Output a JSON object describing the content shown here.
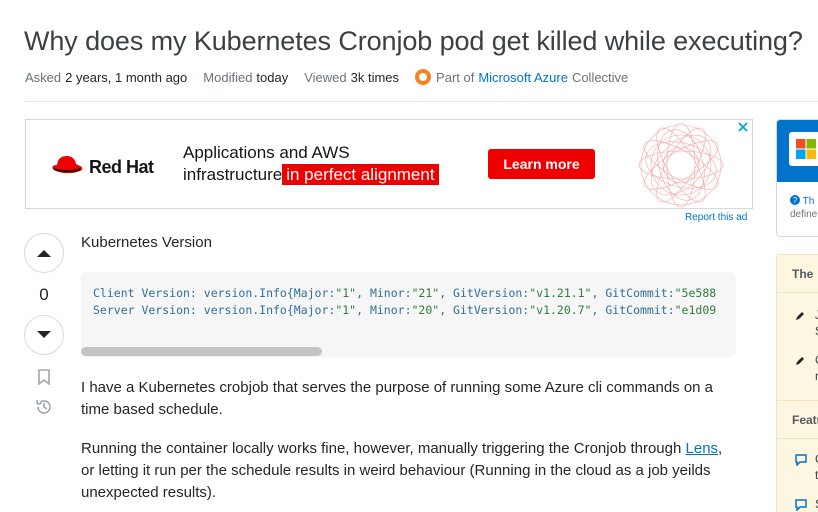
{
  "question": {
    "title": "Why does my Kubernetes Cronjob pod get killed while executing?",
    "asked_label": "Asked",
    "asked_value": "2 years, 1 month ago",
    "modified_label": "Modified",
    "modified_value": "today",
    "viewed_label": "Viewed",
    "viewed_value": "3k times",
    "collective_prefix": "Part of",
    "collective_link": "Microsoft Azure",
    "collective_suffix": "Collective"
  },
  "ad": {
    "brand": "Red Hat",
    "headline_line1": "Applications and AWS",
    "headline_line2": "infrastructure",
    "headline_highlight": "in perfect alignment",
    "cta": "Learn more",
    "report": "Report this ad",
    "colors": {
      "brand_red": "#ee0000"
    }
  },
  "votes": {
    "count": "0"
  },
  "post": {
    "kubernetes_heading": "Kubernetes Version",
    "code_line1_key": "Client Version: version.Info{Major:",
    "code_line1_major": "\"1\"",
    "code_line1_minor_key": ", Minor:",
    "code_line1_minor": "\"21\"",
    "code_line1_git_key": ", GitVersion:",
    "code_line1_git": "\"v1.21.1\"",
    "code_line1_commit_key": ", GitCommit:",
    "code_line1_commit": "\"5e588",
    "code_line2_key": "Server Version: version.Info{Major:",
    "code_line2_major": "\"1\"",
    "code_line2_minor_key": ", Minor:",
    "code_line2_minor": "\"20\"",
    "code_line2_git_key": ", GitVersion:",
    "code_line2_git": "\"v1.20.7\"",
    "code_line2_commit_key": ", GitCommit:",
    "code_line2_commit": "\"e1d09",
    "paragraph1": "I have a Kubernetes crobjob that serves the purpose of running some Azure cli commands on a time based schedule.",
    "paragraph2_before": "Running the container locally works fine, however, manually triggering the Cronjob through ",
    "paragraph2_link": "Lens",
    "paragraph2_after": ", or letting it run per the schedule results in weird behaviour (Running in the cloud as a job yeilds unexpected results)."
  },
  "sidebar": {
    "collective_info": "Th",
    "collective_info2": "define",
    "blog_header": "The",
    "blog_item1_line1": "J",
    "blog_item1_line2": "S",
    "blog_item2_line1": "C",
    "blog_item2_line2": "r",
    "featured_header": "Featu",
    "featured_item1_line1": "C",
    "featured_item1_line2": "t",
    "featured_item2_line1": "S"
  }
}
